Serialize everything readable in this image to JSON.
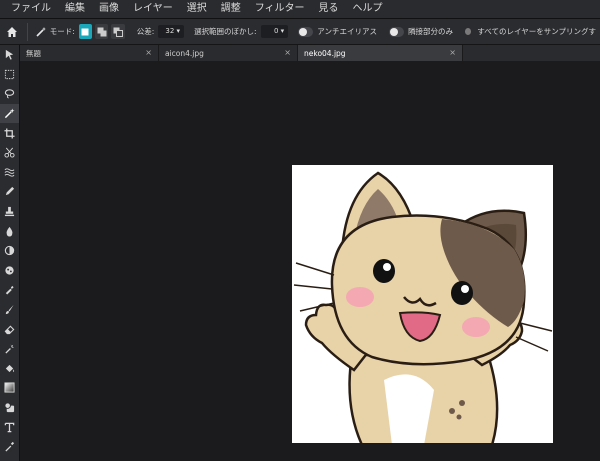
{
  "menu": [
    "ファイル",
    "編集",
    "画像",
    "レイヤー",
    "選択",
    "調整",
    "フィルター",
    "見る",
    "ヘルプ"
  ],
  "options": {
    "mode_label": "モード:",
    "tolerance_label": "公差:",
    "tolerance_value": "32 ▾",
    "feather_label": "選択範囲のぼかし:",
    "feather_value": "0 ▾",
    "antialias_label": "アンチエイリアス",
    "contiguous_label": "隣接部分のみ",
    "sample_all_label": "すべてのレイヤーをサンプリングす"
  },
  "tabs": [
    {
      "label": "無題",
      "close": "×"
    },
    {
      "label": "aicon4.jpg",
      "close": "×"
    },
    {
      "label": "neko04.jpg",
      "close": "×"
    }
  ],
  "tools": [
    "move-tool-icon",
    "marquee-tool-icon",
    "lasso-tool-icon",
    "magic-wand-tool-icon",
    "crop-tool-icon",
    "cut-tool-icon",
    "liquify-tool-icon",
    "pencil-tool-icon",
    "clone-stamp-tool-icon",
    "blur-tool-icon",
    "dodge-tool-icon",
    "sponge-tool-icon",
    "color-picker-tool-icon",
    "brush-tool-icon",
    "eraser-tool-icon",
    "color-replace-tool-icon",
    "fill-tool-icon",
    "gradient-tool-icon",
    "shape-tool-icon",
    "text-tool-icon",
    "eyedropper-tool-icon"
  ],
  "colors": {
    "accent": "#19a7b9",
    "cat_fur": "#e8d2a8",
    "cat_outline": "#3a2a1a",
    "cat_patch": "#6e5a4a"
  }
}
